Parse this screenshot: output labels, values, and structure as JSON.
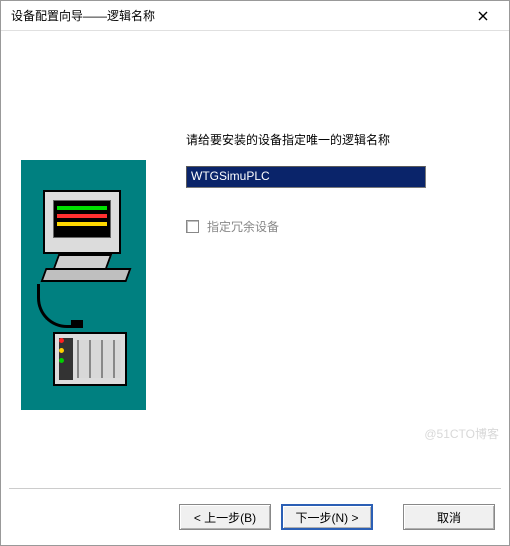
{
  "titlebar": {
    "title": "设备配置向导——逻辑名称"
  },
  "form": {
    "prompt": "请给要安装的设备指定唯一的逻辑名称",
    "device_name_value": "WTGSimuPLC",
    "redundant_label": "指定冗余设备",
    "redundant_checked": false
  },
  "buttons": {
    "back": "< 上一步(B)",
    "next": "下一步(N) >",
    "cancel": "取消"
  },
  "watermark": "@51CTO博客"
}
